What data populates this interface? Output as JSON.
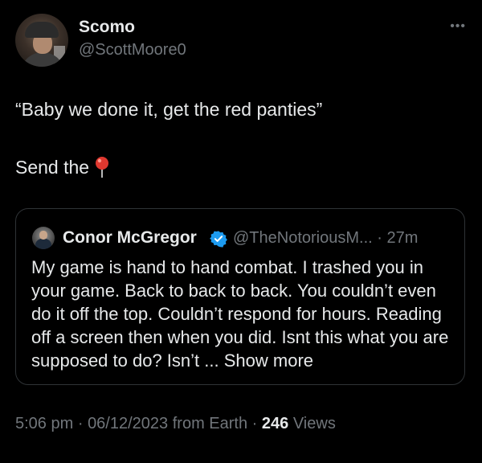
{
  "author": {
    "display_name": "Scomo",
    "handle": "@ScottMoore0",
    "more_icon": "more-dots-icon"
  },
  "tweet": {
    "line1": "“Baby we done it, get the red panties”",
    "line2": "Send the",
    "emoji_icon": "round-pushpin-icon"
  },
  "quote": {
    "display_name": "Conor McGregor",
    "verified_icon": "verified-badge-icon",
    "handle": "@TheNotoriousM...",
    "separator": "·",
    "time": "27m",
    "text": "My game is hand to hand combat. I trashed you in your game. Back to back to back. You couldn’t even do it off the top. Couldn’t respond for hours. Reading off a screen then when you did. Isnt this what you are supposed to do? Isn’t ...",
    "show_more": "Show more"
  },
  "footer": {
    "time": "5:06 pm",
    "separator1": "·",
    "date": "06/12/2023",
    "source": "from Earth",
    "separator2": "·",
    "views_count": "246",
    "views_label": "Views"
  },
  "colors": {
    "background": "#000000",
    "text": "#e7e9ea",
    "secondary": "#71767b",
    "verified": "#1d9bf0",
    "pin": "#e0382f"
  }
}
